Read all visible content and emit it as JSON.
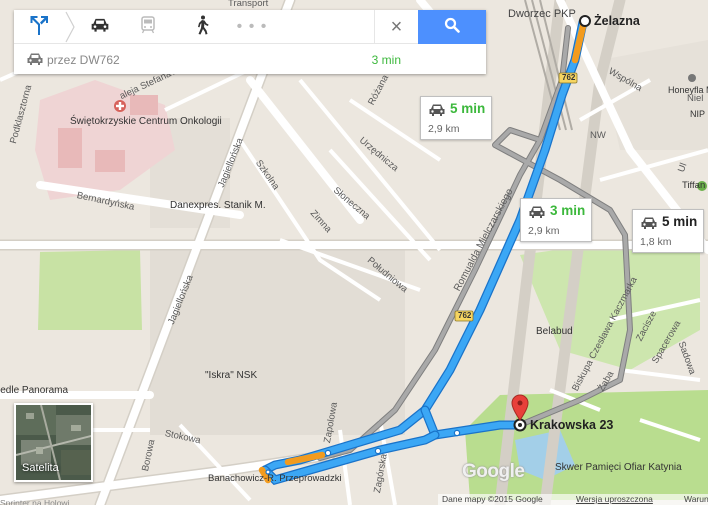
{
  "directions_panel": {
    "modes": [
      {
        "name": "directions",
        "active": true
      },
      {
        "name": "car"
      },
      {
        "name": "transit"
      },
      {
        "name": "walk"
      },
      {
        "name": "more"
      }
    ],
    "more_label": "• • •",
    "close_label": "×",
    "route": {
      "via": "przez DW762",
      "duration": "3 min"
    }
  },
  "route_options": [
    {
      "time": "5 min",
      "distance": "2,9 km",
      "time_color": "#3cb83c"
    },
    {
      "time": "3 min",
      "distance": "2,9 km",
      "time_color": "#3cb83c"
    },
    {
      "time": "5 min",
      "distance": "1,8 km",
      "time_color": "#222222"
    }
  ],
  "endpoints": {
    "start": "Żelazna",
    "destination": "Krakowska 23"
  },
  "route_shields": [
    "762",
    "762"
  ],
  "streets": {
    "transport": "Transport",
    "dworzec": "Dworzec PKP",
    "podklasztorna": "Podklasztorna",
    "artwinskiego": "aleja Stefana Artwińskiego",
    "jagiellonska": "Jagiellońska",
    "jagiellonska2": "Jagiellońska",
    "szkolna": "Szkolna",
    "urzednicza": "Urzędnicza",
    "rozana": "Różana",
    "sloneczna": "Słoneczna",
    "zimna": "Zimna",
    "poludniowa": "Południowa",
    "bernardynska": "Bernardyńska",
    "mielczarskiego": "Romualda Mielczarskiego",
    "wspolna": "Wspólna",
    "niel": "Niel",
    "kaczmarka": "Biskupa Czesława Kaczmarka",
    "zaba": "Żaba",
    "zacisze": "Zacisze",
    "spacerowa": "Spacerowa",
    "sadowa": "Sadowa",
    "stokowa": "Stokowa",
    "borowa": "Borowa",
    "zagorska": "Zagórska",
    "zapolowa": "Zapolowa",
    "nw": "NW",
    "ul": "Ul"
  },
  "pois": {
    "hospital": "Świętokrzyskie Centrum Onkologii",
    "danexpres": "Danexpres. Stanik M.",
    "iskra": "\"Iskra\" NSK",
    "belabud": "Belabud",
    "panorama": "iedle Panorama",
    "banachowicz": "Banachowicz-R. Przeprowadzki",
    "skwer": "Skwer Pamięci Ofiar Katynia",
    "honeyflat": "Honeyfla Maciej Ś",
    "tiffany": "Tiffan",
    "nipz": "NIP",
    "spr": "Sprinter na Holowi..."
  },
  "satellite": {
    "label": "Satelita"
  },
  "branding": {
    "logo": "Google"
  },
  "footer": {
    "map_data": "Dane mapy ©2015 Google",
    "version": "Wersja uproszczona",
    "terms": "Warun"
  },
  "colors": {
    "route_main": "#3ba7f5",
    "route_outline": "#1e88e5",
    "route_alt": "#909090",
    "traffic_slow": "#f29b1e",
    "search_button": "#4d90fe",
    "park": "#b9dd8f"
  }
}
